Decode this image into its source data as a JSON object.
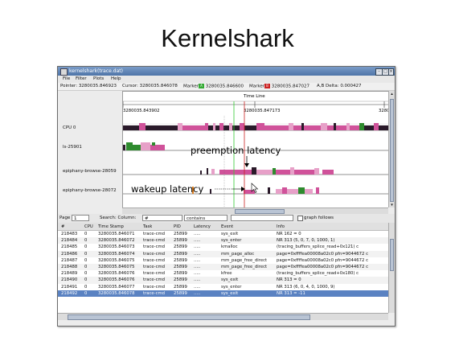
{
  "slide": {
    "title": "Kernelshark"
  },
  "window": {
    "title": "kernelshark(trace.dat)"
  },
  "menu": [
    "File",
    "Filter",
    "Plots",
    "Help"
  ],
  "infobar": {
    "pointer_label": "Pointer:",
    "pointer": "3280035.846923",
    "cursor_label": "Cursor:",
    "cursor": "3280035.846078",
    "marker_a_label": "Marker",
    "marker_a_tag": "A",
    "marker_a": "3280035.846600",
    "marker_b_label": "Marker",
    "marker_b_tag": "B",
    "marker_b": "3280035.847027",
    "delta_label": "A,B Delta:",
    "delta": "0.000427",
    "marker_a_color": "#33aa33",
    "marker_b_color": "#cc2222"
  },
  "graph": {
    "timeline_label": "Time Line",
    "ticks": [
      "3280035.843902",
      "3280035.847173",
      "32800"
    ],
    "rows": [
      "CPU 0",
      "ls-25901",
      "epiphany-browse-28059",
      "epiphany-browse-28072"
    ],
    "annotations": {
      "preemption": "preemption latency",
      "wakeup": "wakeup latency"
    },
    "colors": {
      "pink": "#d0529a",
      "light_pink": "#e7a0c8",
      "dark": "#2a1a2a",
      "green": "#2e8b2e",
      "orange": "#e08020",
      "marker_a": "#33cc33",
      "marker_b": "#cc2222"
    }
  },
  "search": {
    "page_label": "Page",
    "page_value": "1",
    "search_label": "Search: Column:",
    "column_value": "#",
    "op_value": "contains",
    "text_value": "",
    "graph_follows_label": "graph follows"
  },
  "table": {
    "columns": [
      "#",
      "CPU",
      "Time Stamp",
      "Task",
      "PID",
      "Latency",
      "Event",
      "Info"
    ],
    "rows": [
      [
        "218483",
        "0",
        "3280035.846071",
        "trace-cmd",
        "25899",
        ".....",
        "sys_exit",
        "NR 162 = 0"
      ],
      [
        "218484",
        "0",
        "3280035.846072",
        "trace-cmd",
        "25899",
        ".....",
        "sys_enter",
        "NR 313 (5, 0, 7, 0, 1000, 1)"
      ],
      [
        "218485",
        "0",
        "3280035.846073",
        "trace-cmd",
        "25899",
        ".....",
        "kmalloc",
        "(tracing_buffers_splice_read+0x121) c"
      ],
      [
        "218486",
        "0",
        "3280035.846074",
        "trace-cmd",
        "25899",
        ".....",
        "mm_page_alloc",
        "page=0xffffea00008a02c0 pfn=9044672 c"
      ],
      [
        "218487",
        "0",
        "3280035.846075",
        "trace-cmd",
        "25899",
        ".....",
        "mm_page_free_direct",
        "page=0xffffea00008a02c0 pfn=9044672 c"
      ],
      [
        "218488",
        "0",
        "3280035.846075",
        "trace-cmd",
        "25899",
        ".....",
        "mm_page_free_direct",
        "page=0xffffea00008a02c0 pfn=9044672 c"
      ],
      [
        "218489",
        "0",
        "3280035.846076",
        "trace-cmd",
        "25899",
        ".....",
        "kfree",
        "(tracing_buffers_splice_read+0x180) c"
      ],
      [
        "218490",
        "0",
        "3280035.846076",
        "trace-cmd",
        "25899",
        ".....",
        "sys_exit",
        "NR 313 = 0"
      ],
      [
        "218491",
        "0",
        "3280035.846077",
        "trace-cmd",
        "25899",
        ".....",
        "sys_enter",
        "NR 313 (6, 0, 4, 0, 1000, 9)"
      ],
      [
        "218492",
        "0",
        "3280035.846078",
        "trace-cmd",
        "25899",
        ".....",
        "sys_exit",
        "NR 313 = -11"
      ]
    ],
    "selected_index": 9
  }
}
